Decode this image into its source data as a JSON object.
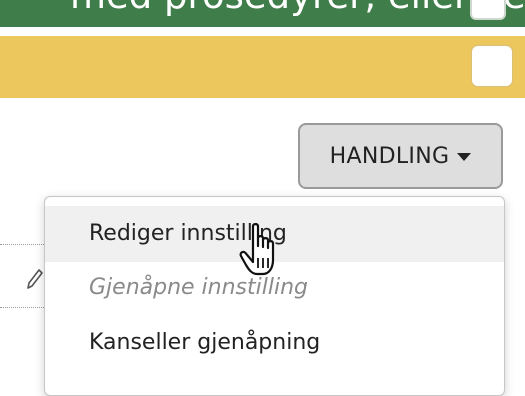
{
  "header": {
    "top_text": "med prosedyrer, eller ved å legge til en",
    "yellow_row_checkbox_checked": false
  },
  "action_button": {
    "label": "HANDLING",
    "icon": "caret-down-icon"
  },
  "dropdown": {
    "items": [
      {
        "label": "Rediger innstilling",
        "state": "hover"
      },
      {
        "label": "Gjenåpne innstilling",
        "state": "disabled"
      },
      {
        "label": "Kanseller gjenåpning",
        "state": "normal"
      }
    ]
  },
  "icons": {
    "row_icon": "pencil-icon",
    "cursor": "hand-pointer-cursor"
  },
  "colors": {
    "top_bar": "#3f7d4a",
    "yellow_row": "#ebc75e",
    "button_bg": "#dedede",
    "disabled_text": "#8a8a8a"
  }
}
